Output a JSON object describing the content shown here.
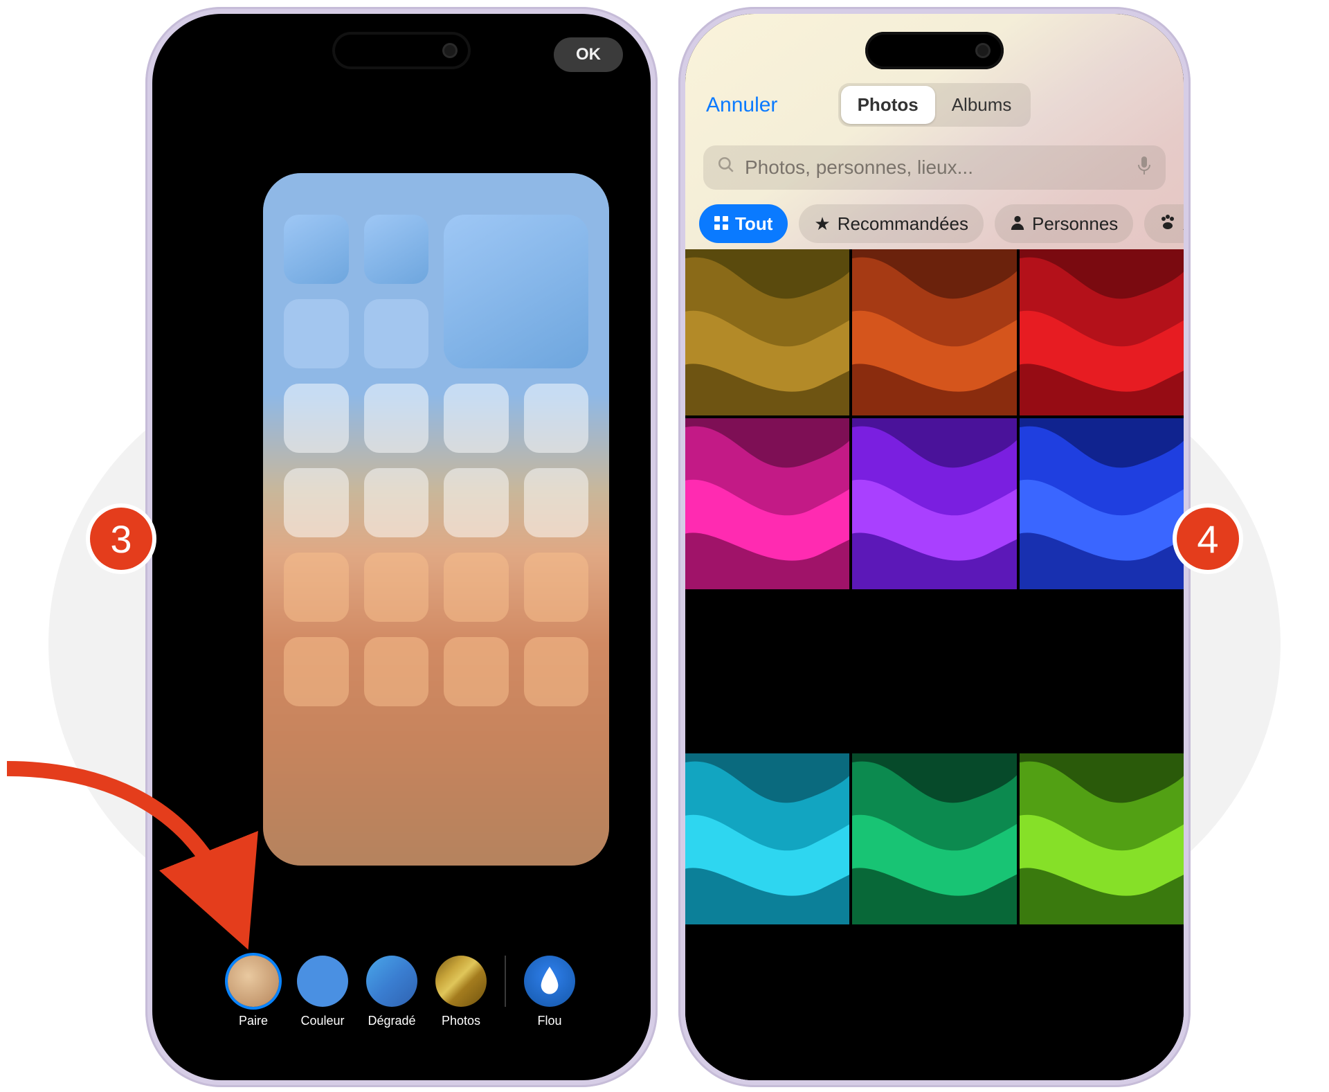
{
  "steps": {
    "three": "3",
    "four": "4"
  },
  "editor": {
    "ok_label": "OK",
    "toolbar": {
      "paire": {
        "label": "Paire"
      },
      "couleur": {
        "label": "Couleur"
      },
      "degrade": {
        "label": "Dégradé"
      },
      "photos": {
        "label": "Photos"
      },
      "flou": {
        "label": "Flou"
      }
    }
  },
  "picker": {
    "cancel": "Annuler",
    "segmented": {
      "photos": "Photos",
      "albums": "Albums"
    },
    "search_placeholder": "Photos, personnes, lieux...",
    "chips": {
      "all": "Tout",
      "recommended": "Recommandées",
      "people": "Personnes",
      "animals_prefix": "A"
    },
    "thumbnails": [
      {
        "name": "wave-olive-brown",
        "c1": "#5a4a0d",
        "c2": "#8a6a18",
        "c3": "#b38a28",
        "c4": "#6e5412"
      },
      {
        "name": "wave-rust-orange",
        "c1": "#6b220c",
        "c2": "#a63a14",
        "c3": "#d5551c",
        "c4": "#8a2c0e"
      },
      {
        "name": "wave-crimson-red",
        "c1": "#7a0a10",
        "c2": "#b4111a",
        "c3": "#e71c22",
        "c4": "#960c14"
      },
      {
        "name": "wave-magenta-pink",
        "c1": "#7e0f55",
        "c2": "#c31a86",
        "c3": "#ff2bb1",
        "c4": "#a01369"
      },
      {
        "name": "wave-purple-violet",
        "c1": "#4a129a",
        "c2": "#7a1fe0",
        "c3": "#a940ff",
        "c4": "#5c18b8"
      },
      {
        "name": "wave-royal-blue",
        "c1": "#10238f",
        "c2": "#1f3fe0",
        "c3": "#3a66ff",
        "c4": "#1830b0"
      },
      {
        "name": "wave-cyan-teal",
        "c1": "#0a6a7e",
        "c2": "#12a5c1",
        "c3": "#2ed6f0",
        "c4": "#0c8099"
      },
      {
        "name": "wave-emerald",
        "c1": "#064a2a",
        "c2": "#0c8a4f",
        "c3": "#18c474",
        "c4": "#086838"
      },
      {
        "name": "wave-lime-green",
        "c1": "#2a5a0a",
        "c2": "#52a014",
        "c3": "#86e028",
        "c4": "#3a7a0e"
      }
    ]
  }
}
